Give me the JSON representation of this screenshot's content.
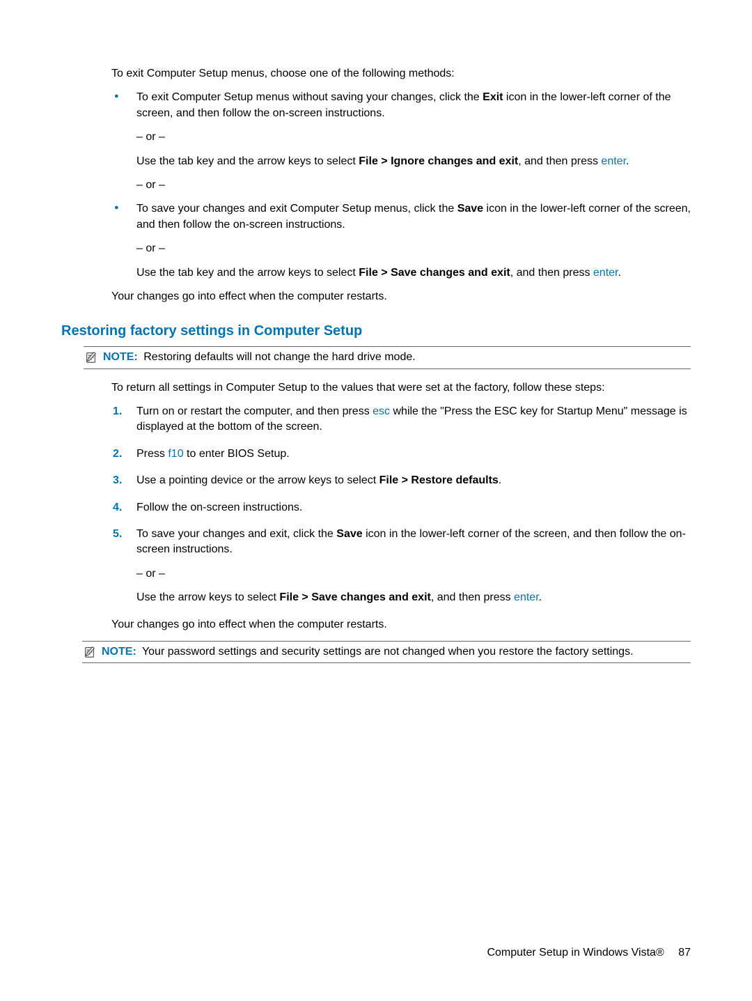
{
  "intro": "To exit Computer Setup menus, choose one of the following methods:",
  "bullets": [
    {
      "line1_a": "To exit Computer Setup menus without saving your changes, click the ",
      "line1_bold": "Exit",
      "line1_b": " icon in the lower-left corner of the screen, and then follow the on-screen instructions.",
      "or1": "– or –",
      "line2_a": "Use the tab key and the arrow keys to select ",
      "line2_bold": "File > Ignore changes and exit",
      "line2_b": ", and then press ",
      "line2_key": "enter",
      "line2_c": ".",
      "or2": "– or –"
    },
    {
      "line1_a": "To save your changes and exit Computer Setup menus, click the ",
      "line1_bold": "Save",
      "line1_b": " icon in the lower-left corner of the screen, and then follow the on-screen instructions.",
      "or1": "– or –",
      "line2_a": "Use the tab key and the arrow keys to select ",
      "line2_bold": "File > Save changes and exit",
      "line2_b": ", and then press ",
      "line2_key": "enter",
      "line2_c": "."
    }
  ],
  "after_bullets": "Your changes go into effect when the computer restarts.",
  "heading": "Restoring factory settings in Computer Setup",
  "note1": {
    "label": "NOTE:",
    "text": "Restoring defaults will not change the hard drive mode."
  },
  "return_intro": "To return all settings in Computer Setup to the values that were set at the factory, follow these steps:",
  "steps": [
    {
      "a": "Turn on or restart the computer, and then press ",
      "key": "esc",
      "b": " while the \"Press the ESC key for Startup Menu\" message is displayed at the bottom of the screen."
    },
    {
      "a": "Press ",
      "key": "f10",
      "b": " to enter BIOS Setup."
    },
    {
      "a": "Use a pointing device or the arrow keys to select ",
      "bold": "File > Restore defaults",
      "b": "."
    },
    {
      "a": "Follow the on-screen instructions."
    },
    {
      "a": "To save your changes and exit, click the ",
      "bold": "Save",
      "b": " icon in the lower-left corner of the screen, and then follow the on-screen instructions.",
      "or": "– or –",
      "c_a": "Use the arrow keys to select ",
      "c_bold": "File > Save changes and exit",
      "c_b": ", and then press ",
      "c_key": "enter",
      "c_c": "."
    }
  ],
  "after_steps": "Your changes go into effect when the computer restarts.",
  "note2": {
    "label": "NOTE:",
    "text": "Your password settings and security settings are not changed when you restore the factory settings."
  },
  "footer": {
    "text": "Computer Setup in Windows Vista®",
    "page": "87"
  }
}
